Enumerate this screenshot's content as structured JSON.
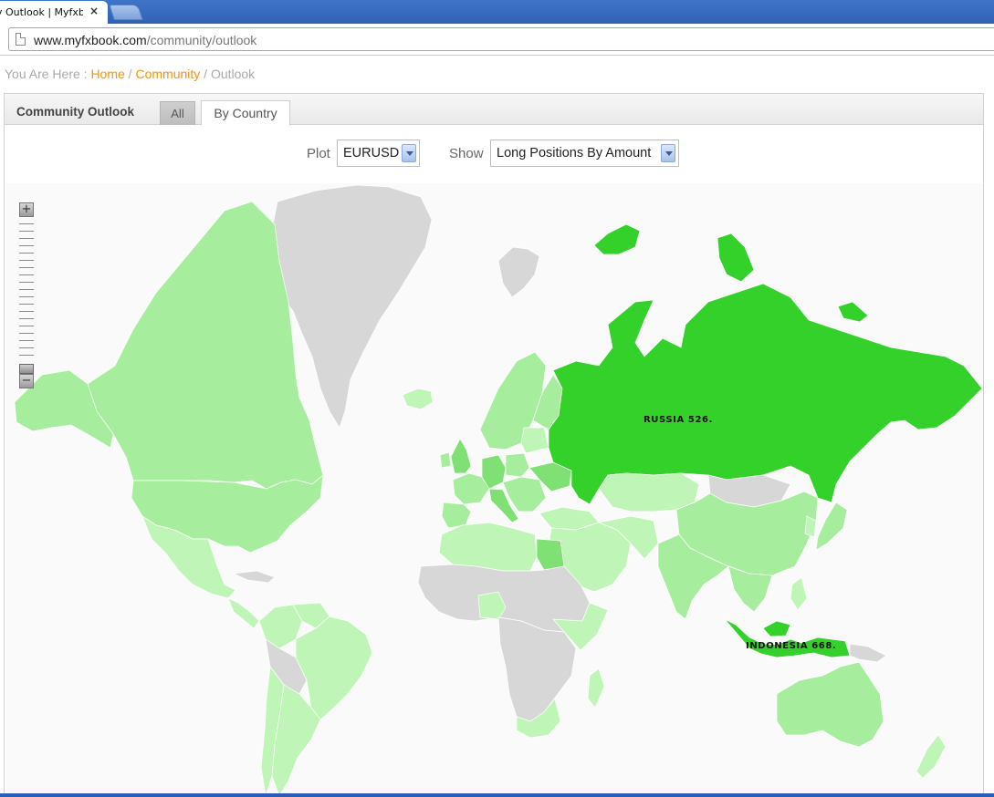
{
  "browser": {
    "tab_title": "y Outlook | Myfxbc",
    "close_glyph": "×",
    "url_domain": "www.myfxbook.com",
    "url_path": "/community/outlook"
  },
  "breadcrumb": {
    "prefix": "You Are Here : ",
    "home": "Home",
    "sep1": " / ",
    "community": "Community",
    "sep2": " / ",
    "current": "Outlook"
  },
  "panel": {
    "title": "Community Outlook",
    "tabs": [
      {
        "label": "All",
        "active": false
      },
      {
        "label": "By Country",
        "active": true
      }
    ]
  },
  "controls": {
    "plot_label": "Plot",
    "plot_value": "EURUSD",
    "show_label": "Show",
    "show_value": "Long Positions By Amount"
  },
  "map": {
    "zoom_in": "+",
    "zoom_out": "−",
    "labels": [
      {
        "country": "RUSSIA",
        "text": "RUSSIA 526."
      },
      {
        "country": "INDONESIA",
        "text": "INDONESIA 668."
      }
    ],
    "colors": {
      "no_data": "#d7d7d7",
      "level_1": "#c0f5b8",
      "level_2": "#a6ee9e",
      "level_3": "#7fe074",
      "level_4": "#34d12b",
      "ocean": "#fafafa"
    }
  }
}
